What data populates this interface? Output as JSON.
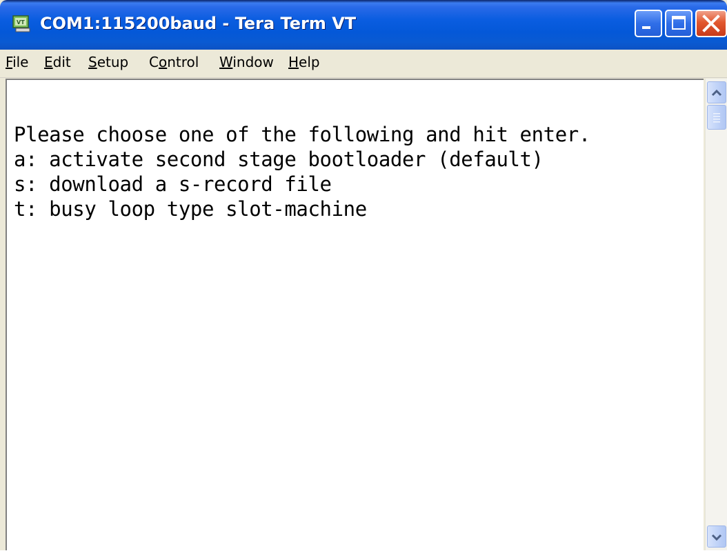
{
  "window": {
    "title": "COM1:115200baud - Tera Term VT",
    "controls": {
      "minimize_icon": "minimize-icon",
      "maximize_icon": "maximize-icon",
      "close_icon": "close-icon"
    }
  },
  "menu": {
    "items": [
      {
        "label_ul": "F",
        "label_rest": "ile"
      },
      {
        "label_ul": "E",
        "label_rest": "dit"
      },
      {
        "label_ul": "S",
        "label_rest": "etup"
      },
      {
        "label_pre": "C",
        "label_ul": "o",
        "label_rest": "ntrol"
      },
      {
        "label_ul": "W",
        "label_rest": "indow"
      },
      {
        "label_ul": "H",
        "label_rest": "elp"
      }
    ]
  },
  "terminal": {
    "lines": [
      "Please choose one of the following and hit enter.",
      "a: activate second stage bootloader (default)",
      "s: download a s-record file",
      "t: busy loop type slot-machine"
    ]
  },
  "colors": {
    "titlebar": "#0a5de0",
    "close_button": "#e2582f",
    "menubar": "#ece9d8",
    "terminal_bg": "#ffffff",
    "terminal_text": "#000000"
  }
}
